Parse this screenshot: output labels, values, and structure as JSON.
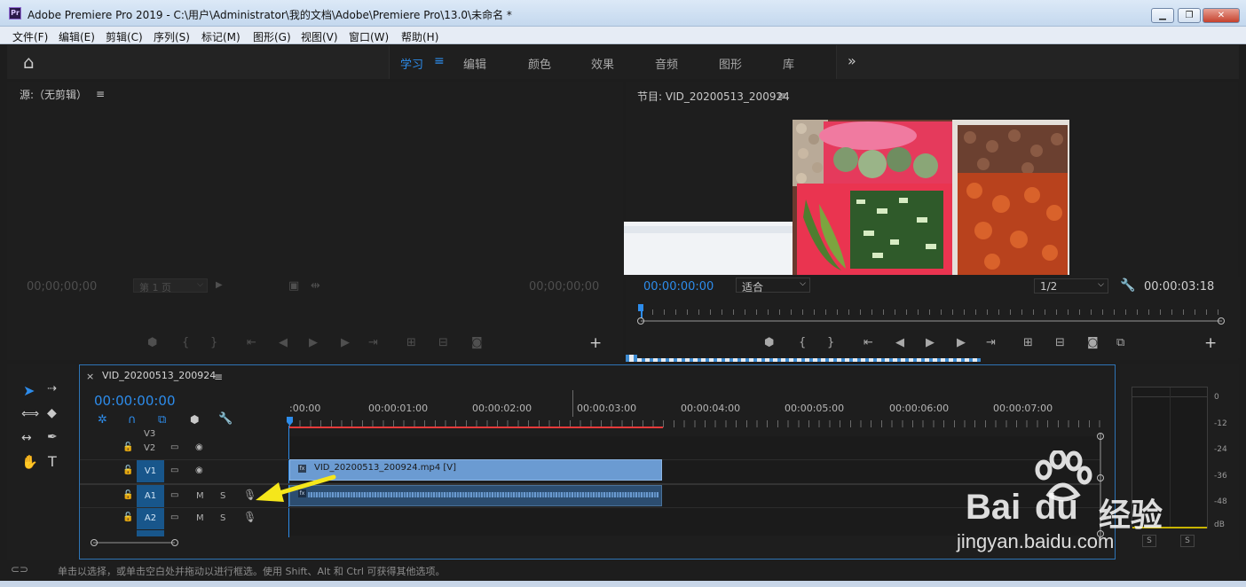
{
  "window": {
    "app_icon": "Pr",
    "title": "Adobe Premiere Pro 2019 - C:\\用户\\Administrator\\我的文档\\Adobe\\Premiere Pro\\13.0\\未命名 *",
    "minimize": "▁",
    "maximize": "❐",
    "close": "✕"
  },
  "menu": [
    "文件(F)",
    "编辑(E)",
    "剪辑(C)",
    "序列(S)",
    "标记(M)",
    "图形(G)",
    "视图(V)",
    "窗口(W)",
    "帮助(H)"
  ],
  "workspaces": {
    "home_icon": "⌂",
    "items": [
      "学习",
      "编辑",
      "颜色",
      "效果",
      "音频",
      "图形",
      "库"
    ],
    "active": "学习",
    "active_menu": "≡",
    "overflow": "»"
  },
  "source": {
    "title": "源:（无剪辑）",
    "menu": "≡",
    "tc_left": "00;00;00;00",
    "page": "第 1 页",
    "tc_right": "00;00;00;00",
    "add": "+"
  },
  "program": {
    "title": "节目: VID_20200513_200924",
    "menu": "≡",
    "tc": "00:00:00:00",
    "fit": "适合",
    "resolution": "1/2",
    "duration": "00:00:03:18",
    "add": "+"
  },
  "timeline": {
    "close": "×",
    "tab": "VID_20200513_200924",
    "menu": "≡",
    "tc": "00:00:00:00",
    "ruler": [
      ":00:00",
      "00:00:01:00",
      "00:00:02:00",
      "00:00:03:00",
      "00:00:04:00",
      "00:00:05:00",
      "00:00:06:00",
      "00:00:07:00"
    ],
    "tracks": {
      "v3": "V3",
      "v2": "V2",
      "v1": "V1",
      "a1": "A1",
      "a2": "A2",
      "mute": "M",
      "solo": "S"
    },
    "clip_label": "VID_20200513_200924.mp4 [V]",
    "clip_fx": "fx",
    "audio_fx": "fx"
  },
  "meter": {
    "scale": [
      "0",
      "-12",
      "-24",
      "-36",
      "-48",
      "dB"
    ],
    "solo_a": "S",
    "solo_b": "S"
  },
  "watermark": {
    "logo": "Bai",
    "logo_du": "du",
    "brand": "经验",
    "url": "jingyan.baidu.com"
  },
  "status": "单击以选择，或单击空白处并拖动以进行框选。使用 Shift、Alt 和 Ctrl 可获得其他选项。",
  "colors": {
    "accent": "#2d8ceb",
    "clip_video": "#6b9bd2",
    "clip_audio": "#2c4d70",
    "work_area": "#e53a3a",
    "arrow": "#f5e61b"
  }
}
